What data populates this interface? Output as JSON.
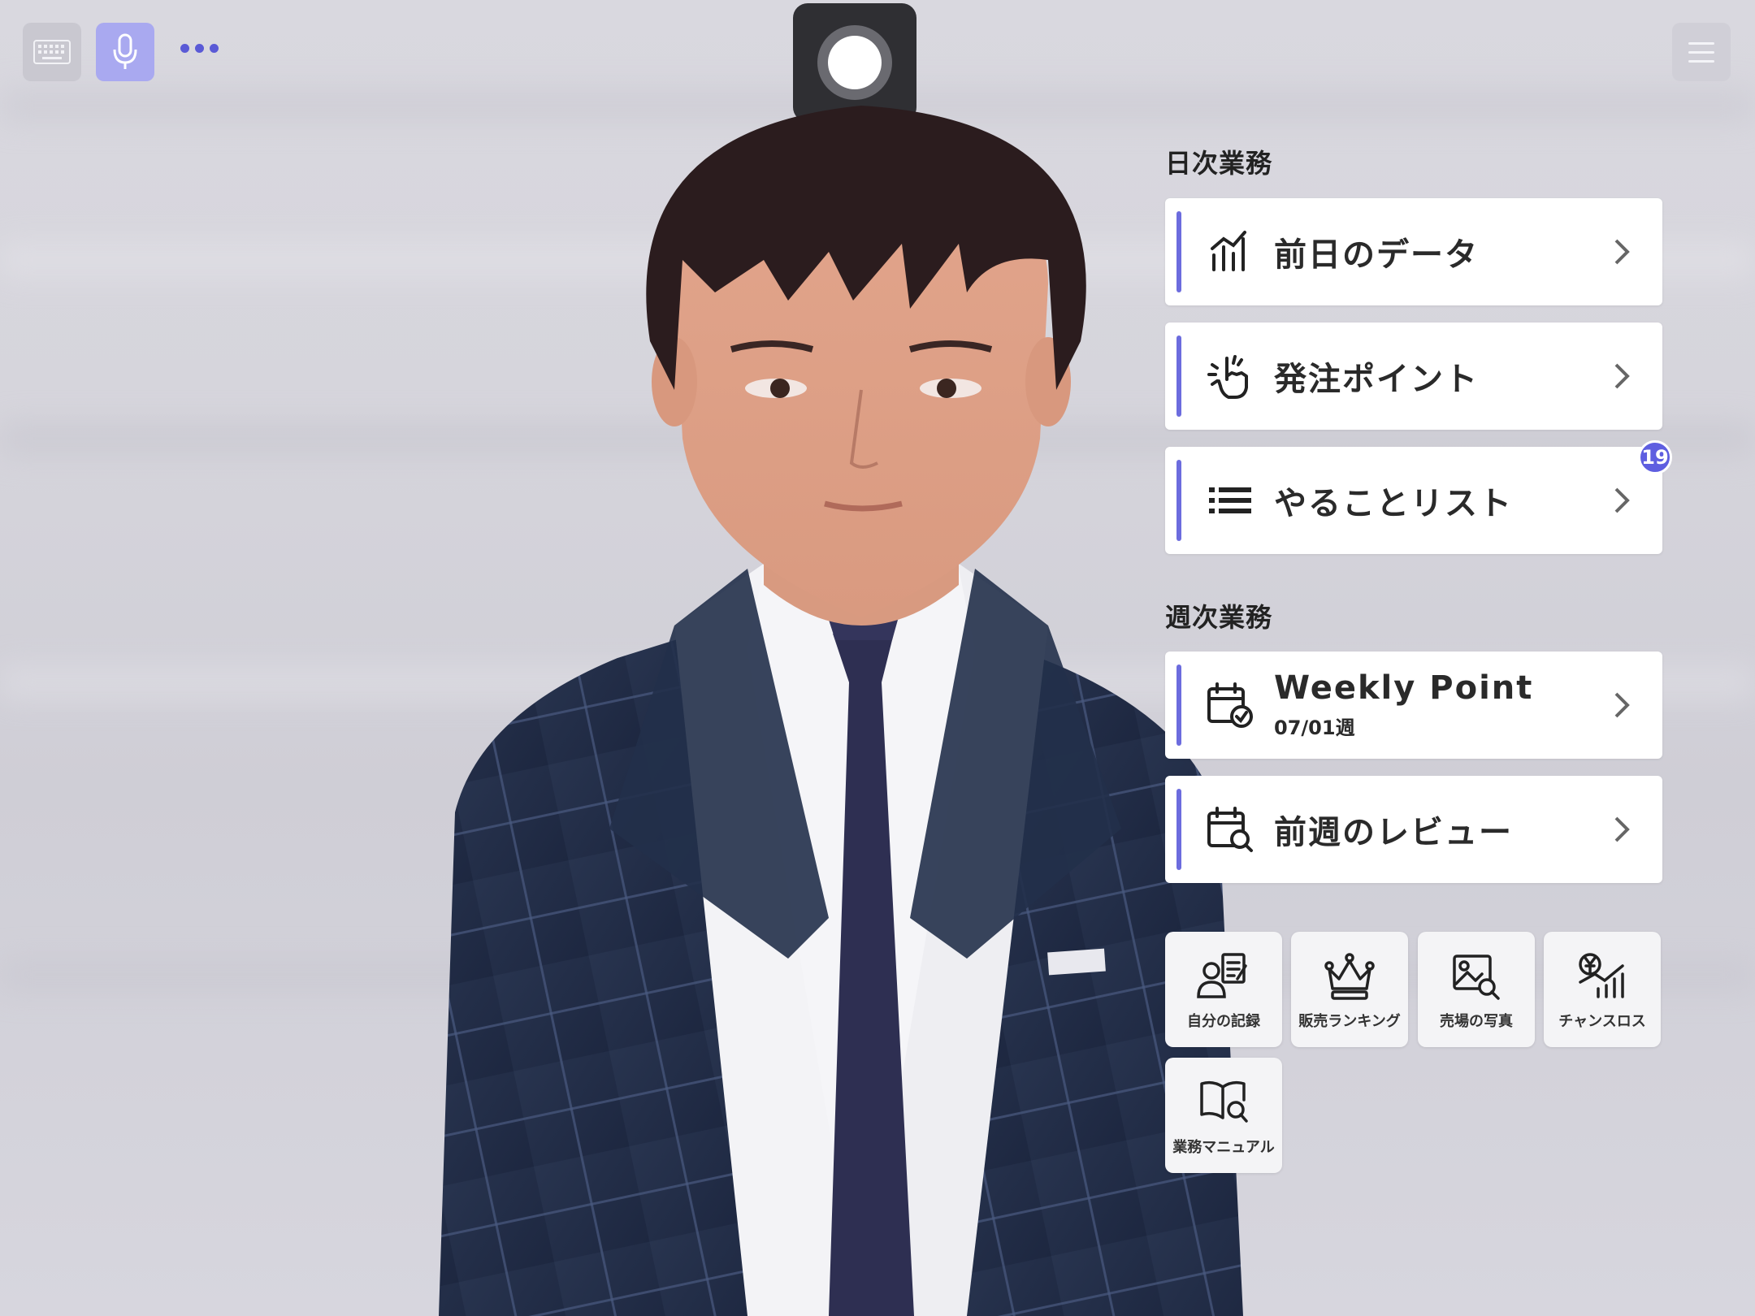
{
  "toolbar": {
    "keyboard_icon": "keyboard-icon",
    "mic_icon": "microphone-icon",
    "more_icon": "more-dots-icon",
    "menu_icon": "hamburger-menu-icon"
  },
  "daily": {
    "title": "日次業務",
    "items": [
      {
        "label": "前日のデータ",
        "icon": "bar-chart-icon"
      },
      {
        "label": "発注ポイント",
        "icon": "finger-point-icon"
      },
      {
        "label": "やることリスト",
        "icon": "list-icon",
        "badge": "19"
      }
    ]
  },
  "weekly": {
    "title": "週次業務",
    "items": [
      {
        "label": "Weekly Point",
        "sub": "07/01週",
        "icon": "calendar-check-icon"
      },
      {
        "label": "前週のレビュー",
        "icon": "calendar-search-icon"
      }
    ]
  },
  "tiles": [
    {
      "label": "自分の記録",
      "icon": "user-record-icon"
    },
    {
      "label": "販売ランキング",
      "icon": "crown-icon"
    },
    {
      "label": "売場の写真",
      "icon": "photo-search-icon"
    },
    {
      "label": "チャンスロス",
      "icon": "yen-chart-icon"
    },
    {
      "label": "業務マニュアル",
      "icon": "manual-book-icon"
    }
  ],
  "colors": {
    "accent": "#6c6cde",
    "badge": "#5e5ee0",
    "card_bg": "#ffffff"
  }
}
